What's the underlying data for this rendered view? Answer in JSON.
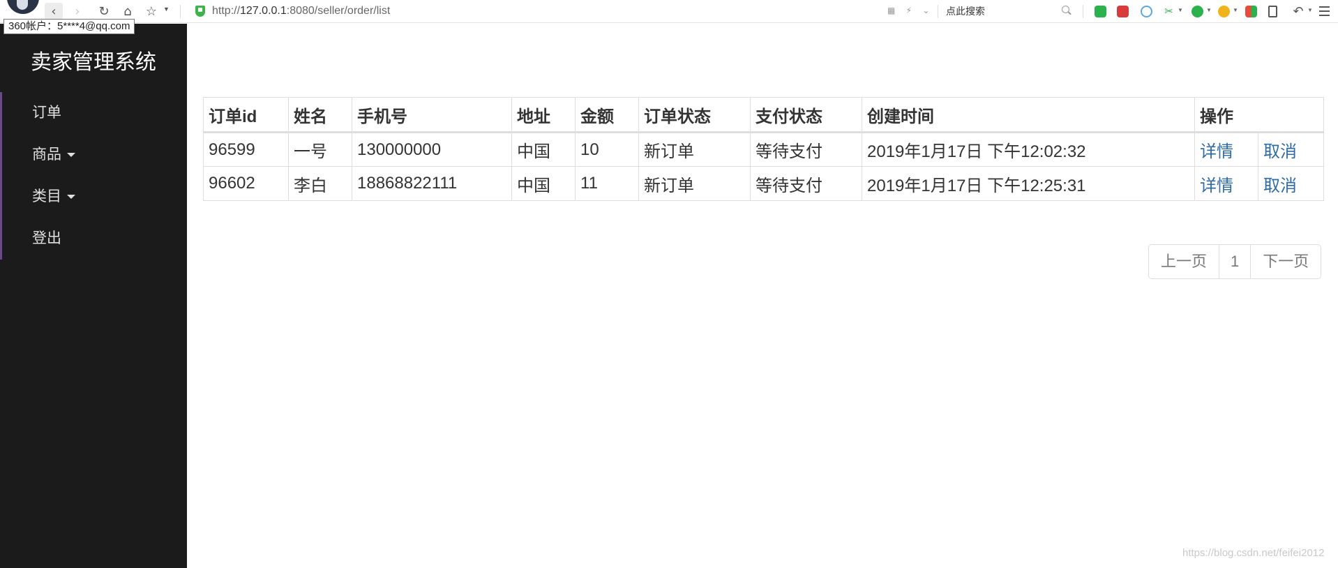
{
  "browser": {
    "url_scheme": "http://",
    "url_host": "127.0.0.1",
    "url_rest": ":8080/seller/order/list",
    "search_placeholder": "点此搜索",
    "account_tooltip": "360帐户：5****4@qq.com",
    "icons": [
      "back-icon",
      "forward-icon",
      "reload-icon",
      "home-icon",
      "star-icon",
      "shield-icon",
      "search-icon",
      "menu-icon"
    ]
  },
  "sidebar": {
    "brand": "卖家管理系统",
    "items": [
      {
        "label": "订单",
        "dropdown": false
      },
      {
        "label": "商品",
        "dropdown": true
      },
      {
        "label": "类目",
        "dropdown": true
      },
      {
        "label": "登出",
        "dropdown": false
      }
    ]
  },
  "table": {
    "headers": [
      "订单id",
      "姓名",
      "手机号",
      "地址",
      "金额",
      "订单状态",
      "支付状态",
      "创建时间",
      "操作"
    ],
    "rows": [
      {
        "id": "96599",
        "name": "一号",
        "phone": "130000000",
        "address": "中国",
        "amount": "10",
        "order_status": "新订单",
        "pay_status": "等待支付",
        "created": "2019年1月17日 下午12:02:32",
        "detail": "详情",
        "cancel": "取消"
      },
      {
        "id": "96602",
        "name": "李白",
        "phone": "18868822111",
        "address": "中国",
        "amount": "11",
        "order_status": "新订单",
        "pay_status": "等待支付",
        "created": "2019年1月17日 下午12:25:31",
        "detail": "详情",
        "cancel": "取消"
      }
    ]
  },
  "pagination": {
    "prev": "上一页",
    "current": "1",
    "next": "下一页"
  },
  "watermark": "https://blog.csdn.net/feifei2012",
  "colors": {
    "sidebar_bg": "#1b1b1b",
    "nav_accent": "#6a4a8c",
    "link": "#2d6ba8"
  }
}
